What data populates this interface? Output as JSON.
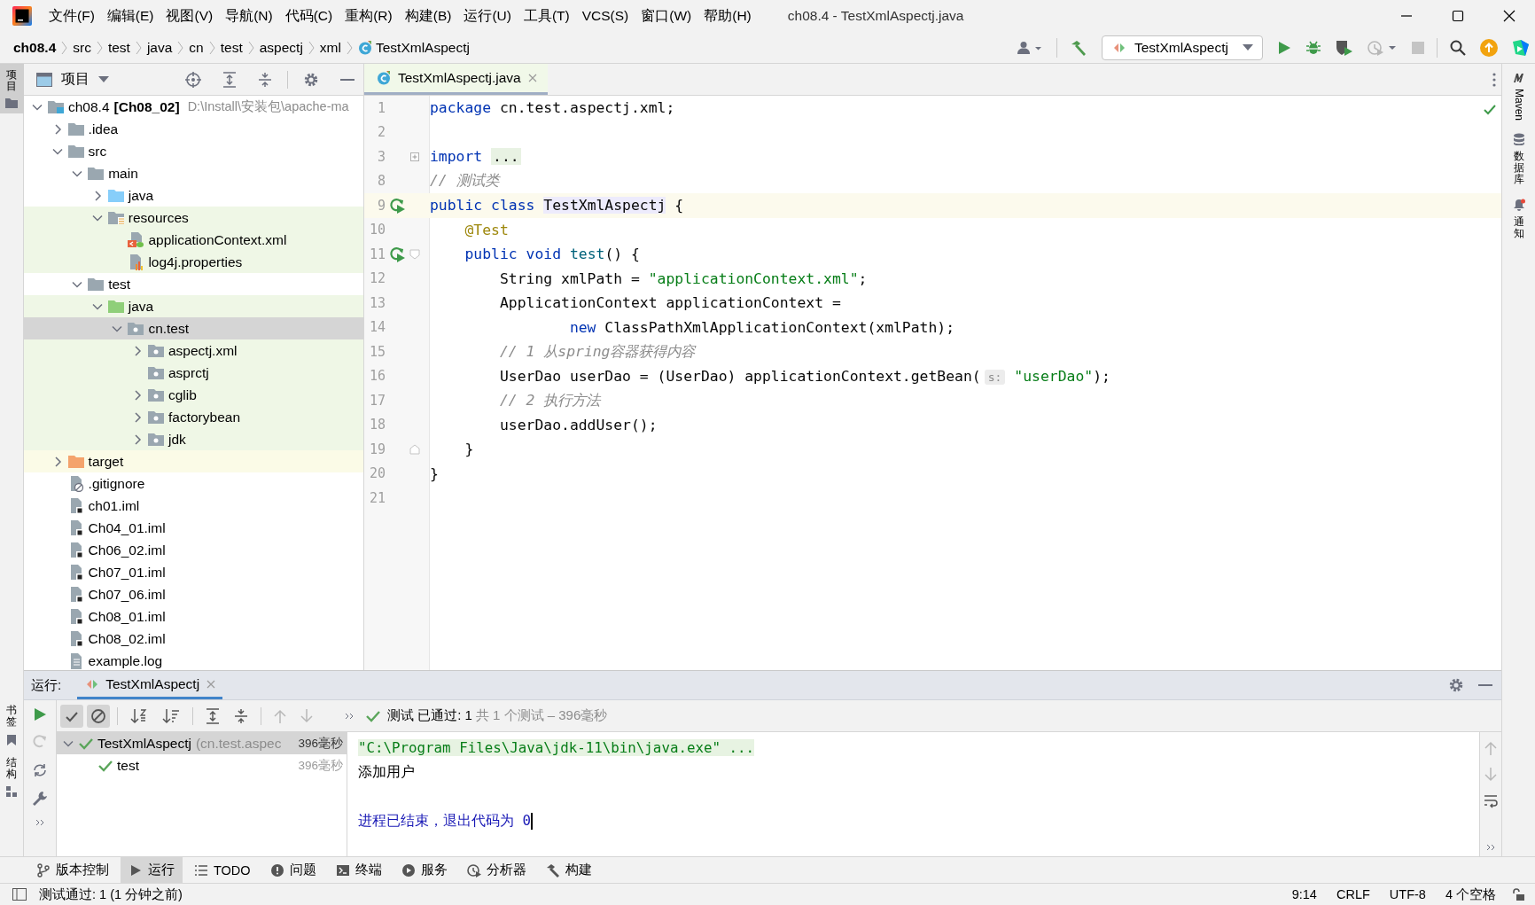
{
  "menu_bar": {
    "items": [
      "文件(F)",
      "编辑(E)",
      "视图(V)",
      "导航(N)",
      "代码(C)",
      "重构(R)",
      "构建(B)",
      "运行(U)",
      "工具(T)",
      "VCS(S)",
      "窗口(W)",
      "帮助(H)"
    ],
    "window_title": "ch08.4 - TestXmlAspectj.java"
  },
  "breadcrumbs": [
    {
      "label": "ch08.4",
      "kind": "project"
    },
    {
      "label": "src",
      "kind": "dir"
    },
    {
      "label": "test",
      "kind": "dir"
    },
    {
      "label": "java",
      "kind": "dir"
    },
    {
      "label": "cn",
      "kind": "dir"
    },
    {
      "label": "test",
      "kind": "dir"
    },
    {
      "label": "aspectj",
      "kind": "dir"
    },
    {
      "label": "xml",
      "kind": "dir"
    },
    {
      "label": "TestXmlAspectj",
      "kind": "class"
    }
  ],
  "toolbar": {
    "run_config": "TestXmlAspectj"
  },
  "left_stripe": {
    "top": [
      {
        "label": "项目",
        "selected": true
      }
    ],
    "bottom": [
      {
        "label": "书签",
        "kind": "bookmarks"
      },
      {
        "label": "结构",
        "kind": "structure"
      }
    ]
  },
  "right_stripe": [
    {
      "label": "Maven",
      "kind": "maven"
    },
    {
      "label": "数据库",
      "kind": "database"
    },
    {
      "label": "通知",
      "kind": "notifications"
    }
  ],
  "project": {
    "title": "项目",
    "tree": [
      {
        "label": "ch08.4",
        "module": "[Ch08_02]",
        "path": "D:\\Install\\安装包\\apache-ma",
        "kind": "module",
        "expanded": true,
        "selected": false,
        "children": [
          {
            "label": ".idea",
            "kind": "folder",
            "expanded": false,
            "selected": false
          },
          {
            "label": "src",
            "kind": "folder",
            "expanded": true,
            "selected": false,
            "children": [
              {
                "label": "main",
                "kind": "folder",
                "expanded": true,
                "selected": false,
                "children": [
                  {
                    "label": "java",
                    "kind": "source",
                    "expanded": false,
                    "selected": false
                  },
                  {
                    "label": "resources",
                    "kind": "resources",
                    "expanded": true,
                    "selected": false,
                    "color": "#eff7e6",
                    "children": [
                      {
                        "label": "applicationContext.xml",
                        "kind": "xml",
                        "selected": false,
                        "color": "#eff7e6"
                      },
                      {
                        "label": "log4j.properties",
                        "kind": "properties",
                        "selected": false,
                        "color": "#eff7e6"
                      }
                    ]
                  }
                ]
              },
              {
                "label": "test",
                "kind": "folder",
                "expanded": true,
                "selected": false,
                "children": [
                  {
                    "label": "java",
                    "kind": "test",
                    "expanded": true,
                    "selected": false,
                    "color": "#eff7e6",
                    "children": [
                      {
                        "label": "cn.test",
                        "kind": "package",
                        "expanded": true,
                        "selected": true,
                        "children": [
                          {
                            "label": "aspectj.xml",
                            "kind": "package",
                            "expanded": false,
                            "selected": false,
                            "color": "#eff7e6"
                          },
                          {
                            "label": "asprctj",
                            "kind": "package",
                            "selected": false,
                            "color": "#eff7e6"
                          },
                          {
                            "label": "cglib",
                            "kind": "package",
                            "expanded": false,
                            "selected": false,
                            "color": "#eff7e6"
                          },
                          {
                            "label": "factorybean",
                            "kind": "package",
                            "expanded": false,
                            "selected": false,
                            "color": "#eff7e6"
                          },
                          {
                            "label": "jdk",
                            "kind": "package",
                            "expanded": false,
                            "selected": false,
                            "color": "#eff7e6"
                          }
                        ]
                      }
                    ]
                  }
                ]
              }
            ]
          },
          {
            "label": "target",
            "kind": "excluded",
            "expanded": false,
            "selected": false,
            "color": "#fbfbe7"
          },
          {
            "label": ".gitignore",
            "kind": "ignore",
            "selected": false
          },
          {
            "label": "ch01.iml",
            "kind": "iml",
            "selected": false
          },
          {
            "label": "Ch04_01.iml",
            "kind": "iml",
            "selected": false
          },
          {
            "label": "Ch06_02.iml",
            "kind": "iml",
            "selected": false
          },
          {
            "label": "Ch07_01.iml",
            "kind": "iml",
            "selected": false
          },
          {
            "label": "Ch07_06.iml",
            "kind": "iml",
            "selected": false
          },
          {
            "label": "Ch08_01.iml",
            "kind": "iml",
            "selected": false
          },
          {
            "label": "Ch08_02.iml",
            "kind": "iml",
            "selected": false
          },
          {
            "label": "example.log",
            "kind": "log",
            "selected": false
          }
        ]
      }
    ]
  },
  "editor": {
    "tabs": [
      {
        "title": "TestXmlAspectj.java",
        "selected": true
      }
    ],
    "lines": [
      {
        "number": "1",
        "tokens": [
          {
            "kind": "kw",
            "text": "package"
          },
          {
            "kind": "plain",
            "text": " cn.test.aspectj.xml;"
          }
        ]
      },
      {
        "number": "2"
      },
      {
        "number": "3",
        "gutter": [
          {
            "kind": "fold-collapsed"
          }
        ],
        "tokens": [
          {
            "kind": "kw",
            "text": "import "
          },
          {
            "kind": "folded",
            "text": "..."
          }
        ]
      },
      {
        "number": "8",
        "tokens": [
          {
            "kind": "comment",
            "text": "// 测试类"
          }
        ]
      },
      {
        "number": "9",
        "current": true,
        "gutter": [
          {
            "kind": "run"
          }
        ],
        "tokens": [
          {
            "kind": "kw",
            "text": "public class "
          },
          {
            "kind": "usage",
            "text": "TestXmlAspectj"
          },
          {
            "kind": "plain",
            "text": " {"
          }
        ]
      },
      {
        "number": "10",
        "tokens": [
          {
            "kind": "annotation",
            "text": "    @Test"
          }
        ]
      },
      {
        "number": "11",
        "gutter": [
          {
            "kind": "run"
          },
          {
            "kind": "fold-start"
          }
        ],
        "tokens": [
          {
            "kind": "kw",
            "text": "    public void "
          },
          {
            "kind": "method",
            "text": "test"
          },
          {
            "kind": "plain",
            "text": "() {"
          }
        ]
      },
      {
        "number": "12",
        "tokens": [
          {
            "kind": "plain",
            "text": "        String xmlPath = "
          },
          {
            "kind": "string",
            "text": "\"applicationContext.xml\""
          },
          {
            "kind": "plain",
            "text": ";"
          }
        ]
      },
      {
        "number": "13",
        "tokens": [
          {
            "kind": "plain",
            "text": "        ApplicationContext applicationContext ="
          }
        ]
      },
      {
        "number": "14",
        "tokens": [
          {
            "kind": "kw",
            "text": "                new"
          },
          {
            "kind": "plain",
            "text": " ClassPathXmlApplicationContext(xmlPath);"
          }
        ]
      },
      {
        "number": "15",
        "tokens": [
          {
            "kind": "comment",
            "text": "        // 1 从spring容器获得内容"
          }
        ]
      },
      {
        "number": "16",
        "tokens": [
          {
            "kind": "plain",
            "text": "        UserDao userDao = (UserDao) applicationContext.getBean("
          },
          {
            "kind": "hint",
            "text": "s:"
          },
          {
            "kind": "string",
            "text": "\"userDao\""
          },
          {
            "kind": "plain",
            "text": ");"
          }
        ]
      },
      {
        "number": "17",
        "tokens": [
          {
            "kind": "comment",
            "text": "        // 2 执行方法"
          }
        ]
      },
      {
        "number": "18",
        "tokens": [
          {
            "kind": "plain",
            "text": "        userDao.addUser();"
          }
        ]
      },
      {
        "number": "19",
        "gutter": [
          {
            "kind": "fold-end"
          }
        ],
        "tokens": [
          {
            "kind": "plain",
            "text": "    }"
          }
        ]
      },
      {
        "number": "20",
        "tokens": [
          {
            "kind": "plain",
            "text": "}"
          }
        ]
      },
      {
        "number": "21"
      }
    ]
  },
  "run_panel": {
    "label": "运行:",
    "tabs": [
      {
        "title": "TestXmlAspectj",
        "selected": true
      }
    ],
    "filters": [
      {
        "kind": "passed",
        "on": true
      },
      {
        "kind": "ignored",
        "on": true
      }
    ],
    "summary": {
      "status": "测试 已通过: 1",
      "detail": "共 1 个测试 – 396毫秒"
    },
    "tests": [
      {
        "name": "TestXmlAspectj",
        "detail": "(cn.test.aspec",
        "time": "396毫秒",
        "passed": true,
        "expanded": true,
        "selected": true,
        "children": [
          {
            "name": "test",
            "time": "396毫秒",
            "passed": true,
            "selected": false
          }
        ]
      }
    ],
    "console": [
      {
        "kind": "command",
        "text": "\"C:\\Program Files\\Java\\jdk-11\\bin\\java.exe\" ..."
      },
      {
        "kind": "output",
        "text": "添加用户"
      },
      {
        "kind": "exit",
        "text": "进程已结束，退出代码为 0"
      }
    ]
  },
  "tool_windows": [
    {
      "label": "版本控制",
      "kind": "vcs",
      "selected": false
    },
    {
      "label": "运行",
      "kind": "run",
      "selected": true
    },
    {
      "label": "TODO",
      "kind": "todo",
      "selected": false
    },
    {
      "label": "问题",
      "kind": "problems",
      "selected": false
    },
    {
      "label": "终端",
      "kind": "terminal",
      "selected": false
    },
    {
      "label": "服务",
      "kind": "services",
      "selected": false
    },
    {
      "label": "分析器",
      "kind": "profiler",
      "selected": false
    },
    {
      "label": "构建",
      "kind": "build",
      "selected": false
    }
  ],
  "status_bar": {
    "message": "测试通过: 1 (1 分钟之前)",
    "items": [
      "9:14",
      "CRLF",
      "UTF-8",
      "4 个空格"
    ]
  }
}
